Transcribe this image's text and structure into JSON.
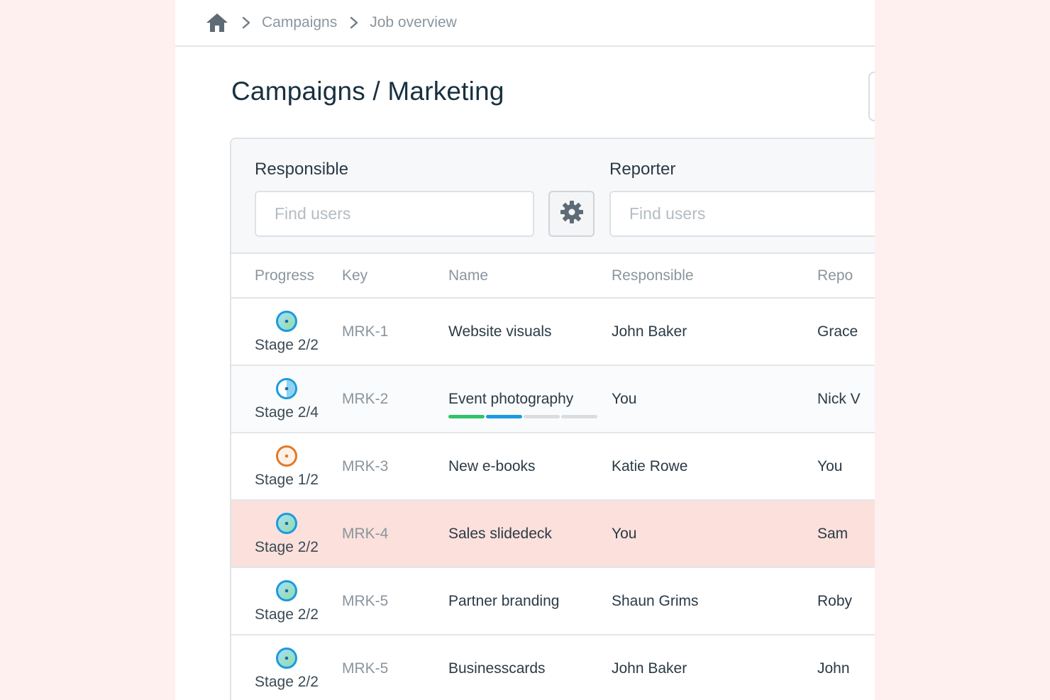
{
  "breadcrumb": {
    "items": [
      "Campaigns",
      "Job overview"
    ]
  },
  "page": {
    "title": "Campaigns / Marketing"
  },
  "filters": {
    "responsible_label": "Responsible",
    "responsible_placeholder": "Find users",
    "reporter_label": "Reporter",
    "reporter_placeholder": "Find users"
  },
  "table": {
    "headers": [
      "Progress",
      "Key",
      "Name",
      "Responsible",
      "Repo"
    ],
    "rows": [
      {
        "stage": "Stage 2/2",
        "key": "MRK-1",
        "name": "Website visuals",
        "responsible": "John Baker",
        "reporter": "Grace",
        "ring": "complete"
      },
      {
        "stage": "Stage 2/4",
        "key": "MRK-2",
        "name": "Event photography",
        "responsible": "You",
        "reporter": "Nick V",
        "ring": "partial",
        "progress": 0.5
      },
      {
        "stage": "Stage 1/2",
        "key": "MRK-3",
        "name": "New e-books",
        "responsible": "Katie Rowe",
        "reporter": "You",
        "ring": "early"
      },
      {
        "stage": "Stage 2/2",
        "key": "MRK-4",
        "name": "Sales slidedeck",
        "responsible": "You",
        "reporter": "Sam",
        "ring": "complete",
        "highlighted": true
      },
      {
        "stage": "Stage 2/2",
        "key": "MRK-5",
        "name": "Partner branding",
        "responsible": "Shaun Grims",
        "reporter": "Roby",
        "ring": "complete"
      },
      {
        "stage": "Stage 2/2",
        "key": "MRK-5",
        "name": "Businesscards",
        "responsible": "John Baker",
        "reporter": "John",
        "ring": "complete"
      }
    ]
  },
  "colors": {
    "highlight_row": "#fbe0dc",
    "progress_green": "#2fc36b",
    "progress_blue": "#1a9be0",
    "ring_blue": "#1a9be0",
    "ring_orange": "#e07a2a"
  },
  "icons": {
    "home": "home-icon",
    "separator": "chevron-right-icon",
    "settings": "gear-icon"
  }
}
